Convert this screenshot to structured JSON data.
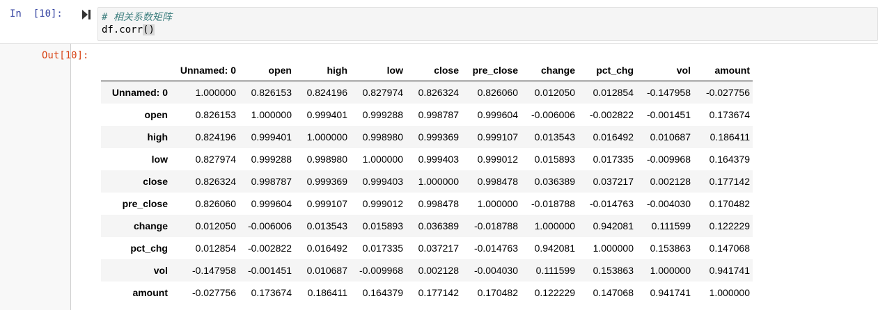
{
  "cell": {
    "in_prompt": "In  [10]:",
    "code_comment": "# 相关系数矩阵",
    "code_prefix": "df.corr",
    "code_open_paren": "(",
    "code_close_paren": ")",
    "out_prompt": "Out[10]:"
  },
  "table": {
    "index_header": "",
    "columns": [
      "Unnamed: 0",
      "open",
      "high",
      "low",
      "close",
      "pre_close",
      "change",
      "pct_chg",
      "vol",
      "amount"
    ],
    "rows": [
      {
        "label": "Unnamed: 0",
        "values": [
          "1.000000",
          "0.826153",
          "0.824196",
          "0.827974",
          "0.826324",
          "0.826060",
          "0.012050",
          "0.012854",
          "-0.147958",
          "-0.027756"
        ]
      },
      {
        "label": "open",
        "values": [
          "0.826153",
          "1.000000",
          "0.999401",
          "0.999288",
          "0.998787",
          "0.999604",
          "-0.006006",
          "-0.002822",
          "-0.001451",
          "0.173674"
        ]
      },
      {
        "label": "high",
        "values": [
          "0.824196",
          "0.999401",
          "1.000000",
          "0.998980",
          "0.999369",
          "0.999107",
          "0.013543",
          "0.016492",
          "0.010687",
          "0.186411"
        ]
      },
      {
        "label": "low",
        "values": [
          "0.827974",
          "0.999288",
          "0.998980",
          "1.000000",
          "0.999403",
          "0.999012",
          "0.015893",
          "0.017335",
          "-0.009968",
          "0.164379"
        ]
      },
      {
        "label": "close",
        "values": [
          "0.826324",
          "0.998787",
          "0.999369",
          "0.999403",
          "1.000000",
          "0.998478",
          "0.036389",
          "0.037217",
          "0.002128",
          "0.177142"
        ]
      },
      {
        "label": "pre_close",
        "values": [
          "0.826060",
          "0.999604",
          "0.999107",
          "0.999012",
          "0.998478",
          "1.000000",
          "-0.018788",
          "-0.014763",
          "-0.004030",
          "0.170482"
        ]
      },
      {
        "label": "change",
        "values": [
          "0.012050",
          "-0.006006",
          "0.013543",
          "0.015893",
          "0.036389",
          "-0.018788",
          "1.000000",
          "0.942081",
          "0.111599",
          "0.122229"
        ]
      },
      {
        "label": "pct_chg",
        "values": [
          "0.012854",
          "-0.002822",
          "0.016492",
          "0.017335",
          "0.037217",
          "-0.014763",
          "0.942081",
          "1.000000",
          "0.153863",
          "0.147068"
        ]
      },
      {
        "label": "vol",
        "values": [
          "-0.147958",
          "-0.001451",
          "0.010687",
          "-0.009968",
          "0.002128",
          "-0.004030",
          "0.111599",
          "0.153863",
          "1.000000",
          "0.941741"
        ]
      },
      {
        "label": "amount",
        "values": [
          "-0.027756",
          "0.173674",
          "0.186411",
          "0.164379",
          "0.177142",
          "0.170482",
          "0.122229",
          "0.147068",
          "0.941741",
          "1.000000"
        ]
      }
    ]
  }
}
